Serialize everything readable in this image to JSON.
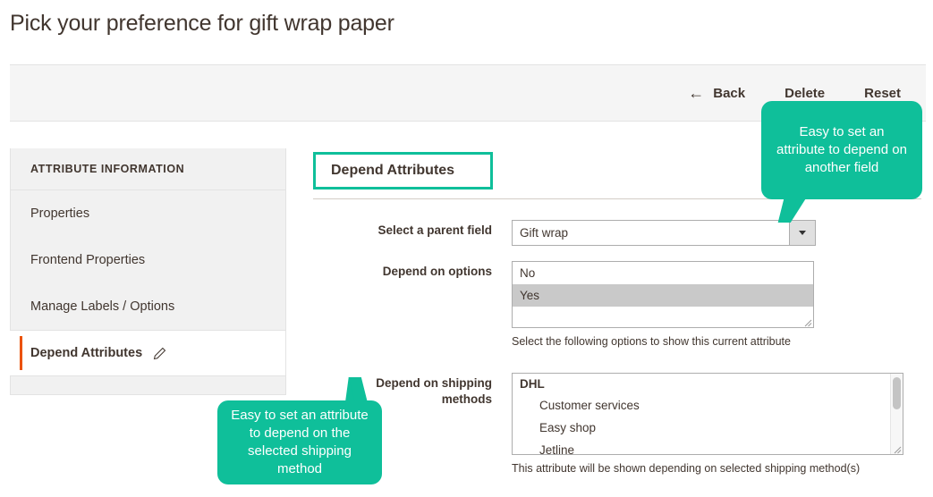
{
  "page": {
    "title": "Pick your preference for gift wrap paper"
  },
  "toolbar": {
    "back_label": "Back",
    "back_icon": "arrow-left-icon",
    "back_arrow_glyph": "←",
    "delete_label": "Delete",
    "reset_label": "Reset"
  },
  "sidebar": {
    "header": "ATTRIBUTE INFORMATION",
    "items": [
      {
        "label": "Properties",
        "active": false
      },
      {
        "label": "Frontend Properties",
        "active": false
      },
      {
        "label": "Manage Labels / Options",
        "active": false
      },
      {
        "label": "Depend Attributes",
        "active": true,
        "icon": "pencil-icon"
      }
    ]
  },
  "main": {
    "section_title": "Depend Attributes",
    "parent_field": {
      "label": "Select a parent field",
      "value": "Gift wrap",
      "icon": "chevron-down-icon"
    },
    "depend_options": {
      "label": "Depend on options",
      "options": [
        {
          "text": "No",
          "selected": false
        },
        {
          "text": "Yes",
          "selected": true
        }
      ],
      "help": "Select the following options to show this current attribute"
    },
    "shipping_methods": {
      "label_line1": "Depend on shipping",
      "label_line2": "methods",
      "group": "DHL",
      "options": [
        {
          "text": "Customer services",
          "selected": false
        },
        {
          "text": "Easy shop",
          "selected": false
        },
        {
          "text": "Jetline",
          "selected": false
        }
      ],
      "help": "This attribute will be shown depending on selected shipping method(s)"
    }
  },
  "callouts": [
    {
      "text": "Easy to set an attribute to depend on another field"
    },
    {
      "text": "Easy to set an attribute to depend on the selected shipping method"
    }
  ],
  "colors": {
    "accent_teal": "#0fbf9a",
    "active_marker_orange": "#eb5202",
    "toolbar_bg": "#f5f5f5",
    "sidebar_bg": "#f1f1f1",
    "text": "#41362f"
  }
}
